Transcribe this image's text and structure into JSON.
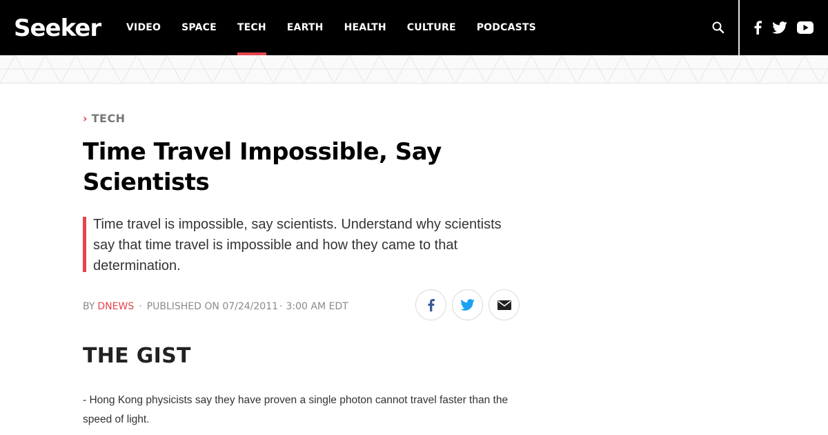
{
  "header": {
    "logo_text": "Seeker",
    "nav": [
      {
        "label": "VIDEO",
        "active": false
      },
      {
        "label": "SPACE",
        "active": false
      },
      {
        "label": "TECH",
        "active": true
      },
      {
        "label": "EARTH",
        "active": false
      },
      {
        "label": "HEALTH",
        "active": false
      },
      {
        "label": "CULTURE",
        "active": false
      },
      {
        "label": "PODCASTS",
        "active": false
      }
    ],
    "icons": [
      "search-icon",
      "facebook-icon",
      "twitter-icon",
      "youtube-icon"
    ]
  },
  "article": {
    "category": "TECH",
    "title": "Time Travel Impossible, Say Scientists",
    "deck": "Time travel is impossible, say scientists. Understand why scientists say that time travel is impossible and how they came to that determination.",
    "byline": {
      "by": "BY",
      "author": "DNEWS",
      "published": "PUBLISHED ON 07/24/2011",
      "time": "3:00 AM EDT"
    },
    "share_icons": [
      "facebook-icon",
      "twitter-icon",
      "email-icon"
    ],
    "section_heading": "THE GIST",
    "body": "- Hong Kong physicists say they have proven a single photon cannot travel faster than the speed of light."
  },
  "colors": {
    "accent": "#e8434d",
    "header_bg": "#000000",
    "facebook": "#3b5998",
    "twitter": "#1da1f2"
  }
}
